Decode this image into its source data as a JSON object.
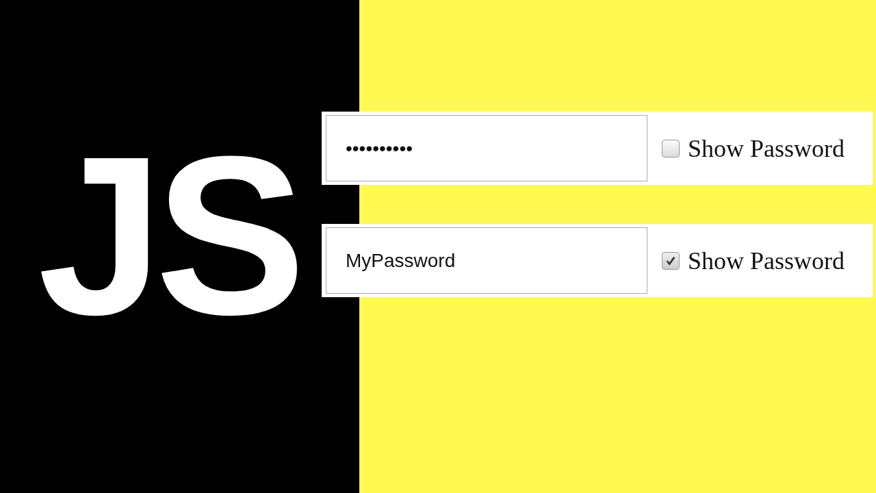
{
  "logo": {
    "text": "JS"
  },
  "rows": [
    {
      "value": "••••••••••",
      "checked": false,
      "label": "Show Password"
    },
    {
      "value": "MyPassword",
      "checked": true,
      "label": "Show Password"
    }
  ]
}
